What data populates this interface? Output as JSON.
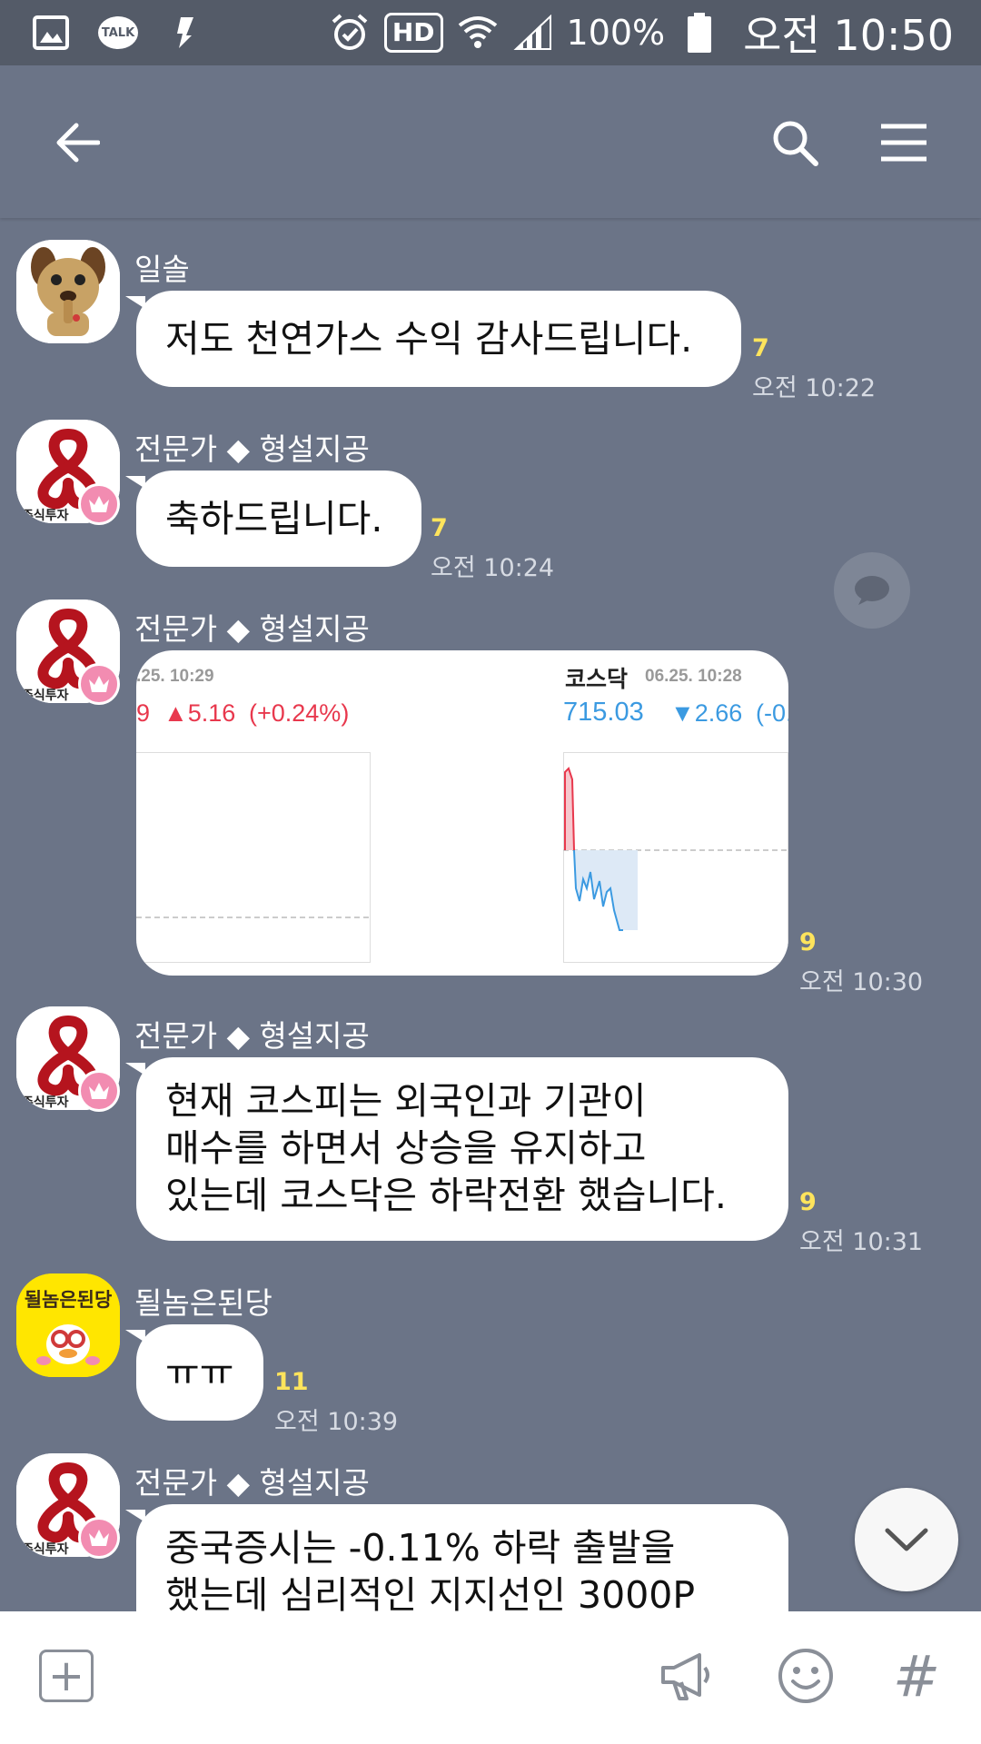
{
  "status_bar": {
    "talk_label": "TALK",
    "hd_label": "HD",
    "battery": "100%",
    "clock": "오전 10:50",
    "icons": [
      "gallery-icon",
      "talk-icon",
      "dictionary-icon",
      "alarm-icon",
      "hd-icon",
      "wifi-icon",
      "signal-icon",
      "battery-icon"
    ]
  },
  "header": {
    "icons": [
      "back-arrow-icon",
      "search-icon",
      "menu-icon"
    ]
  },
  "messages": [
    {
      "sender": "일솔",
      "text": "저도 천연가스 수익 감사드립니다.",
      "unread": "7",
      "time": "오전 10:22"
    },
    {
      "sender": "전문가 ◆ 형설지공",
      "text": "축하드립니다.",
      "unread": "7",
      "time": "오전 10:24"
    },
    {
      "sender": "전문가 ◆ 형설지공",
      "unread": "9",
      "time": "오전 10:30",
      "image": {
        "left_date": ".25. 10:29",
        "left_value": "9",
        "left_change": "▲5.16",
        "left_pct": "(+0.24%)",
        "right_name": "코스닥",
        "right_date": "06.25. 10:28",
        "right_value": "715.03",
        "right_change": "▼2.66",
        "right_pct": "(-0."
      }
    },
    {
      "sender": "전문가 ◆ 형설지공",
      "lines": [
        "현재 코스피는 외국인과 기관이",
        "매수를 하면서 상승을 유지하고",
        "있는데 코스닥은 하락전환 했습니다."
      ],
      "unread": "9",
      "time": "오전 10:31"
    },
    {
      "sender": "될놈은된당",
      "text": "ㅠㅠ",
      "unread": "11",
      "time": "오전 10:39"
    },
    {
      "sender": "전문가 ◆ 형설지공",
      "lines": [
        "중국증시는 -0.11% 하락 출발을",
        "했는데 심리적인 지지선인 3000P"
      ]
    }
  ],
  "avatars": {
    "expert_logo_text": "주식투자",
    "sticker_text": "될놈은된당"
  },
  "input_bar": {
    "hash_label": "#",
    "icons": [
      "add-icon",
      "megaphone-icon",
      "emoticon-icon",
      "hashtag-icon"
    ]
  },
  "colors": {
    "chat_background": "#6b7487",
    "status_bar": "#545b68",
    "unread": "#ffe45c",
    "stock_up": "#e8384d",
    "stock_down": "#3b9ae1",
    "crown_badge": "#f28cb1"
  }
}
